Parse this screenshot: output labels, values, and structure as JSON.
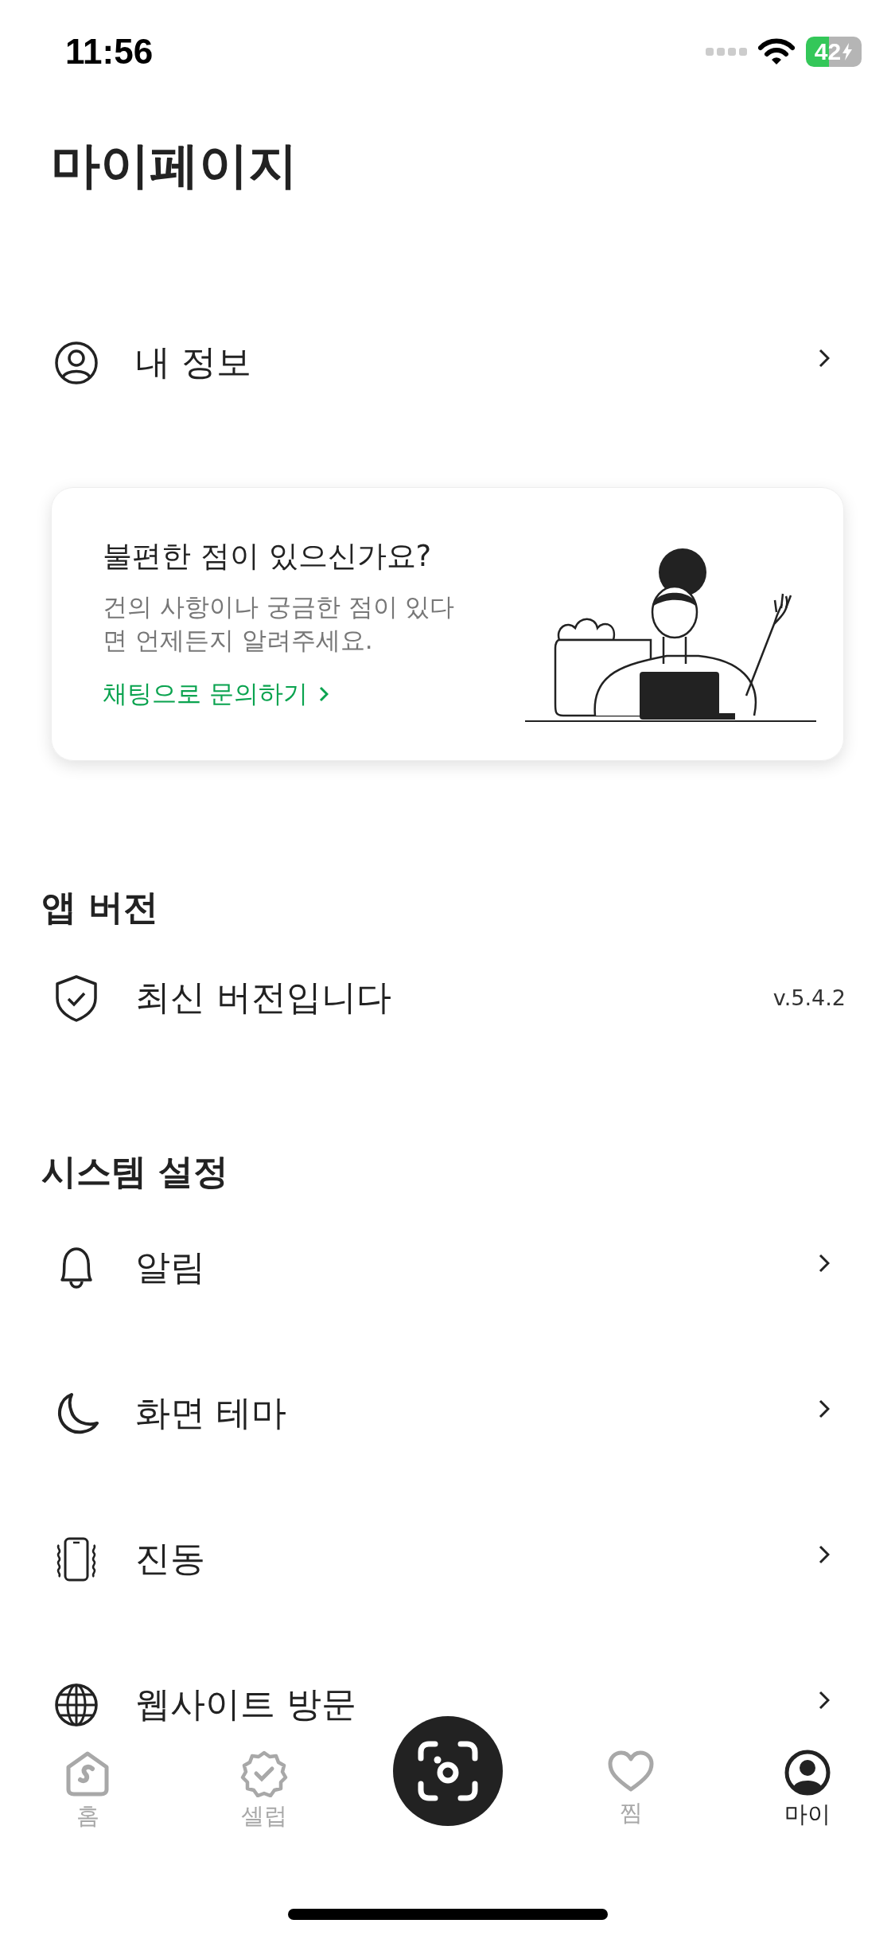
{
  "status_bar": {
    "time": "11:56",
    "battery": "42"
  },
  "title": "마이페이지",
  "profile_row": {
    "label": "내 정보"
  },
  "help_card": {
    "title": "불편한 점이 있으신가요?",
    "body": "건의 사항이나 궁금한 점이 있다면 언제든지 알려주세요.",
    "link": "채팅으로 문의하기"
  },
  "app_version": {
    "heading": "앱 버전",
    "status": "최신 버전입니다",
    "version": "v.5.4.2"
  },
  "system_settings": {
    "heading": "시스템 설정",
    "items": [
      {
        "label": "알림",
        "kind": "bell"
      },
      {
        "label": "화면 테마",
        "kind": "moon"
      },
      {
        "label": "진동",
        "kind": "vibrate"
      },
      {
        "label": "웹사이트 방문",
        "kind": "globe"
      }
    ]
  },
  "tab_bar": [
    {
      "label": "홈",
      "kind": "home",
      "selected": false
    },
    {
      "kind": "badge",
      "label": "셀럽",
      "selected": false
    },
    {
      "kind": "camera",
      "selected": false
    },
    {
      "kind": "heart",
      "label": "찜",
      "selected": false
    },
    {
      "kind": "profile",
      "label": "마이",
      "selected": true
    }
  ]
}
